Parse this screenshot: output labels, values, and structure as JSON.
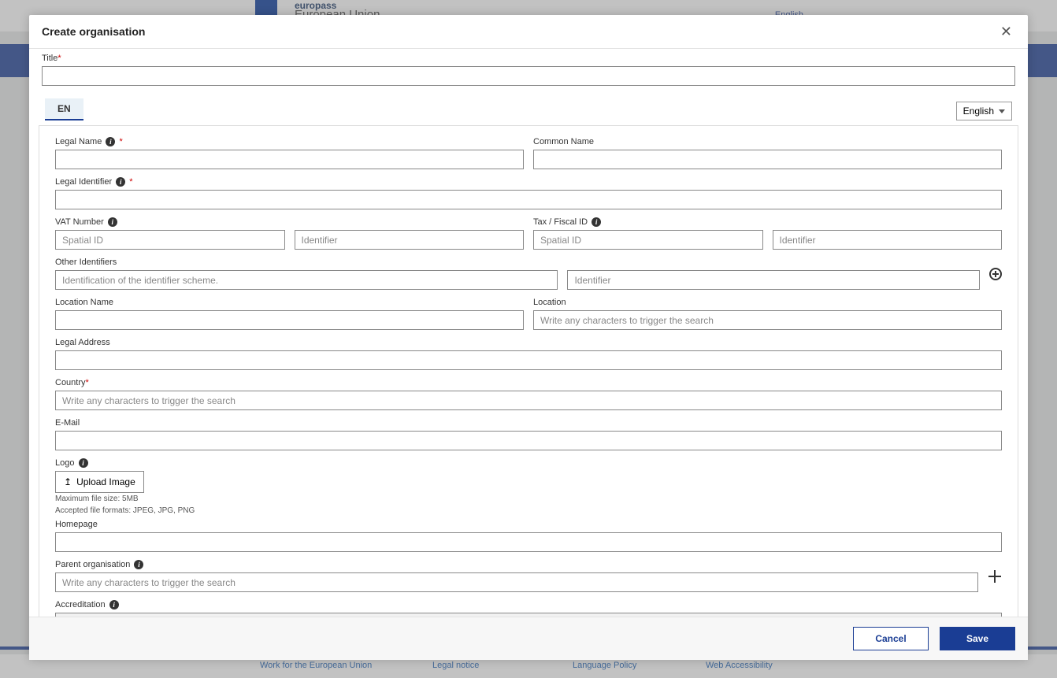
{
  "bg": {
    "brand_top": "europass",
    "brand_bottom": "European Union",
    "lang": "English",
    "footer": {
      "work": "Work for the European Union",
      "legal": "Legal notice",
      "langpol": "Language Policy",
      "web": "Web Accessibility"
    }
  },
  "modal": {
    "title": "Create organisation",
    "tab": "EN",
    "language": "English",
    "labels": {
      "title": "Title",
      "legal_name": "Legal Name",
      "common_name": "Common Name",
      "legal_identifier": "Legal Identifier",
      "vat_number": "VAT Number",
      "tax_fiscal_id": "Tax / Fiscal ID",
      "other_identifiers": "Other Identifiers",
      "location_name": "Location Name",
      "location": "Location",
      "legal_address": "Legal Address",
      "country": "Country",
      "email": "E-Mail",
      "logo": "Logo",
      "upload": "Upload Image",
      "file_size": "Maximum file size: 5MB",
      "file_formats": "Accepted file formats: JPEG, JPG, PNG",
      "homepage": "Homepage",
      "parent_org": "Parent organisation",
      "accreditation": "Accreditation"
    },
    "placeholders": {
      "spatial_id": "Spatial ID",
      "identifier": "Identifier",
      "scheme": "Identification of the identifier scheme.",
      "search": "Write any characters to trigger the search"
    },
    "buttons": {
      "cancel": "Cancel",
      "save": "Save"
    }
  }
}
